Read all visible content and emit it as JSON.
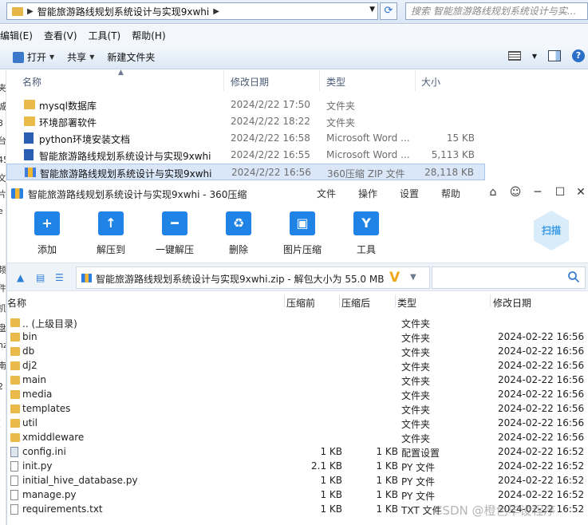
{
  "explorer": {
    "address_path": "智能旅游路线规划系统设计与实现9xwhi",
    "search_placeholder": "搜索 智能旅游路线规划系统设计与实...",
    "menu": [
      "编辑(E)",
      "查看(V)",
      "工具(T)",
      "帮助(H)"
    ],
    "toolbar": {
      "open": "打开",
      "share": "共享",
      "new_folder": "新建文件夹"
    },
    "columns": {
      "name": "名称",
      "date": "修改日期",
      "type": "类型",
      "size": "大小"
    },
    "left_strip_chars": [
      "夹",
      "城",
      "3",
      "台",
      "45",
      "文",
      "片",
      "e",
      "频",
      "件",
      "机",
      "盘",
      "nz",
      "南",
      "2",
      "("
    ],
    "files": [
      {
        "name": "mysql数据库",
        "date": "2024/2/22 17:50",
        "type": "文件夹",
        "size": "",
        "icon": "folder-icon"
      },
      {
        "name": "环境部署软件",
        "date": "2024/2/22 18:22",
        "type": "文件夹",
        "size": "",
        "icon": "folder-icon"
      },
      {
        "name": "python环境安装文档",
        "date": "2024/2/22 16:58",
        "type": "Microsoft Word ...",
        "size": "15 KB",
        "icon": "word-doc-icon"
      },
      {
        "name": "智能旅游路线规划系统设计与实现9xwhi",
        "date": "2024/2/22 16:55",
        "type": "Microsoft Word ...",
        "size": "5,113 KB",
        "icon": "word-doc-icon"
      },
      {
        "name": "智能旅游路线规划系统设计与实现9xwhi",
        "date": "2024/2/22 16:56",
        "type": "360压缩 ZIP 文件",
        "size": "28,118 KB",
        "icon": "zip-icon",
        "selected": true
      }
    ]
  },
  "zip": {
    "title": "智能旅游路线规划系统设计与实现9xwhi - 360压缩",
    "menu": [
      "文件",
      "操作",
      "设置",
      "帮助"
    ],
    "actions": [
      {
        "label": "添加",
        "icon": "add-icon",
        "glyph": "+"
      },
      {
        "label": "解压到",
        "icon": "extract-to-icon",
        "glyph": "↑"
      },
      {
        "label": "一键解压",
        "icon": "one-click-extract-icon",
        "glyph": "━"
      },
      {
        "label": "删除",
        "icon": "trash-icon",
        "glyph": "♻"
      },
      {
        "label": "图片压缩",
        "icon": "image-compress-icon",
        "glyph": "▣"
      },
      {
        "label": "工具",
        "icon": "tools-icon",
        "glyph": "Y"
      }
    ],
    "scan_label": "扫描",
    "path_text": "智能旅游路线规划系统设计与实现9xwhi.zip - 解包大小为 55.0 MB",
    "columns": {
      "name": "名称",
      "before": "压缩前",
      "after": "压缩后",
      "type": "类型",
      "date": "修改日期"
    },
    "rows": [
      {
        "name": ".. (上级目录)",
        "before": "",
        "after": "",
        "type": "文件夹",
        "date": "",
        "icon": "folder"
      },
      {
        "name": "bin",
        "before": "",
        "after": "",
        "type": "文件夹",
        "date": "2024-02-22 16:56",
        "icon": "folder"
      },
      {
        "name": "db",
        "before": "",
        "after": "",
        "type": "文件夹",
        "date": "2024-02-22 16:56",
        "icon": "folder"
      },
      {
        "name": "dj2",
        "before": "",
        "after": "",
        "type": "文件夹",
        "date": "2024-02-22 16:56",
        "icon": "folder"
      },
      {
        "name": "main",
        "before": "",
        "after": "",
        "type": "文件夹",
        "date": "2024-02-22 16:56",
        "icon": "folder"
      },
      {
        "name": "media",
        "before": "",
        "after": "",
        "type": "文件夹",
        "date": "2024-02-22 16:56",
        "icon": "folder"
      },
      {
        "name": "templates",
        "before": "",
        "after": "",
        "type": "文件夹",
        "date": "2024-02-22 16:56",
        "icon": "folder"
      },
      {
        "name": "util",
        "before": "",
        "after": "",
        "type": "文件夹",
        "date": "2024-02-22 16:56",
        "icon": "folder"
      },
      {
        "name": "xmiddleware",
        "before": "",
        "after": "",
        "type": "文件夹",
        "date": "2024-02-22 16:56",
        "icon": "folder"
      },
      {
        "name": "config.ini",
        "before": "1 KB",
        "after": "1 KB",
        "type": "配置设置",
        "date": "2024-02-22 16:52",
        "icon": "ini"
      },
      {
        "name": "init.py",
        "before": "2.1 KB",
        "after": "1 KB",
        "type": "PY 文件",
        "date": "2024-02-22 16:52",
        "icon": "file"
      },
      {
        "name": "initial_hive_database.py",
        "before": "1 KB",
        "after": "1 KB",
        "type": "PY 文件",
        "date": "2024-02-22 16:52",
        "icon": "file"
      },
      {
        "name": "manage.py",
        "before": "1 KB",
        "after": "1 KB",
        "type": "PY 文件",
        "date": "2024-02-22 16:52",
        "icon": "file"
      },
      {
        "name": "requirements.txt",
        "before": "1 KB",
        "after": "1 KB",
        "type": "TXT 文件",
        "date": "2024-02-22 16:52",
        "icon": "file"
      }
    ]
  },
  "watermark": "CSDN @橙色毕设程序"
}
